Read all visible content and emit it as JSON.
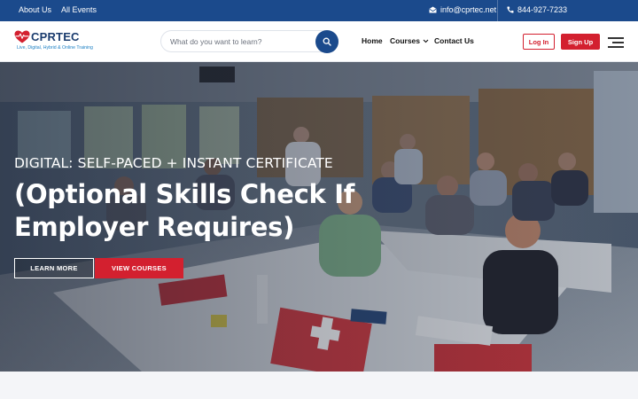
{
  "topbar": {
    "about_label": "About Us",
    "events_label": "All Events",
    "email": "info@cprtec.net",
    "phone": "844-927-7233",
    "email_icon": "envelope-icon",
    "phone_icon": "phone-icon"
  },
  "header": {
    "logo_name": "CPRTEC",
    "logo_tagline": "Live, Digital, Hybrid & Online Training",
    "search_placeholder": "What do you want to learn?",
    "search_value": "",
    "nav": {
      "home": "Home",
      "courses": "Courses",
      "contact": "Contact Us"
    },
    "login_label": "Log In",
    "signup_label": "Sign Up"
  },
  "hero": {
    "subtitle": "DIGITAL: SELF-PACED + INSTANT CERTIFICATE",
    "title": "(Optional Skills Check If Employer Requires)",
    "learn_more_label": "LEARN MORE",
    "view_courses_label": "VIEW COURSES"
  },
  "colors": {
    "brand_blue": "#1b4a8c",
    "brand_red": "#d3202f",
    "logo_blue": "#1b3c6e",
    "tagline_blue": "#1b7fc4"
  }
}
